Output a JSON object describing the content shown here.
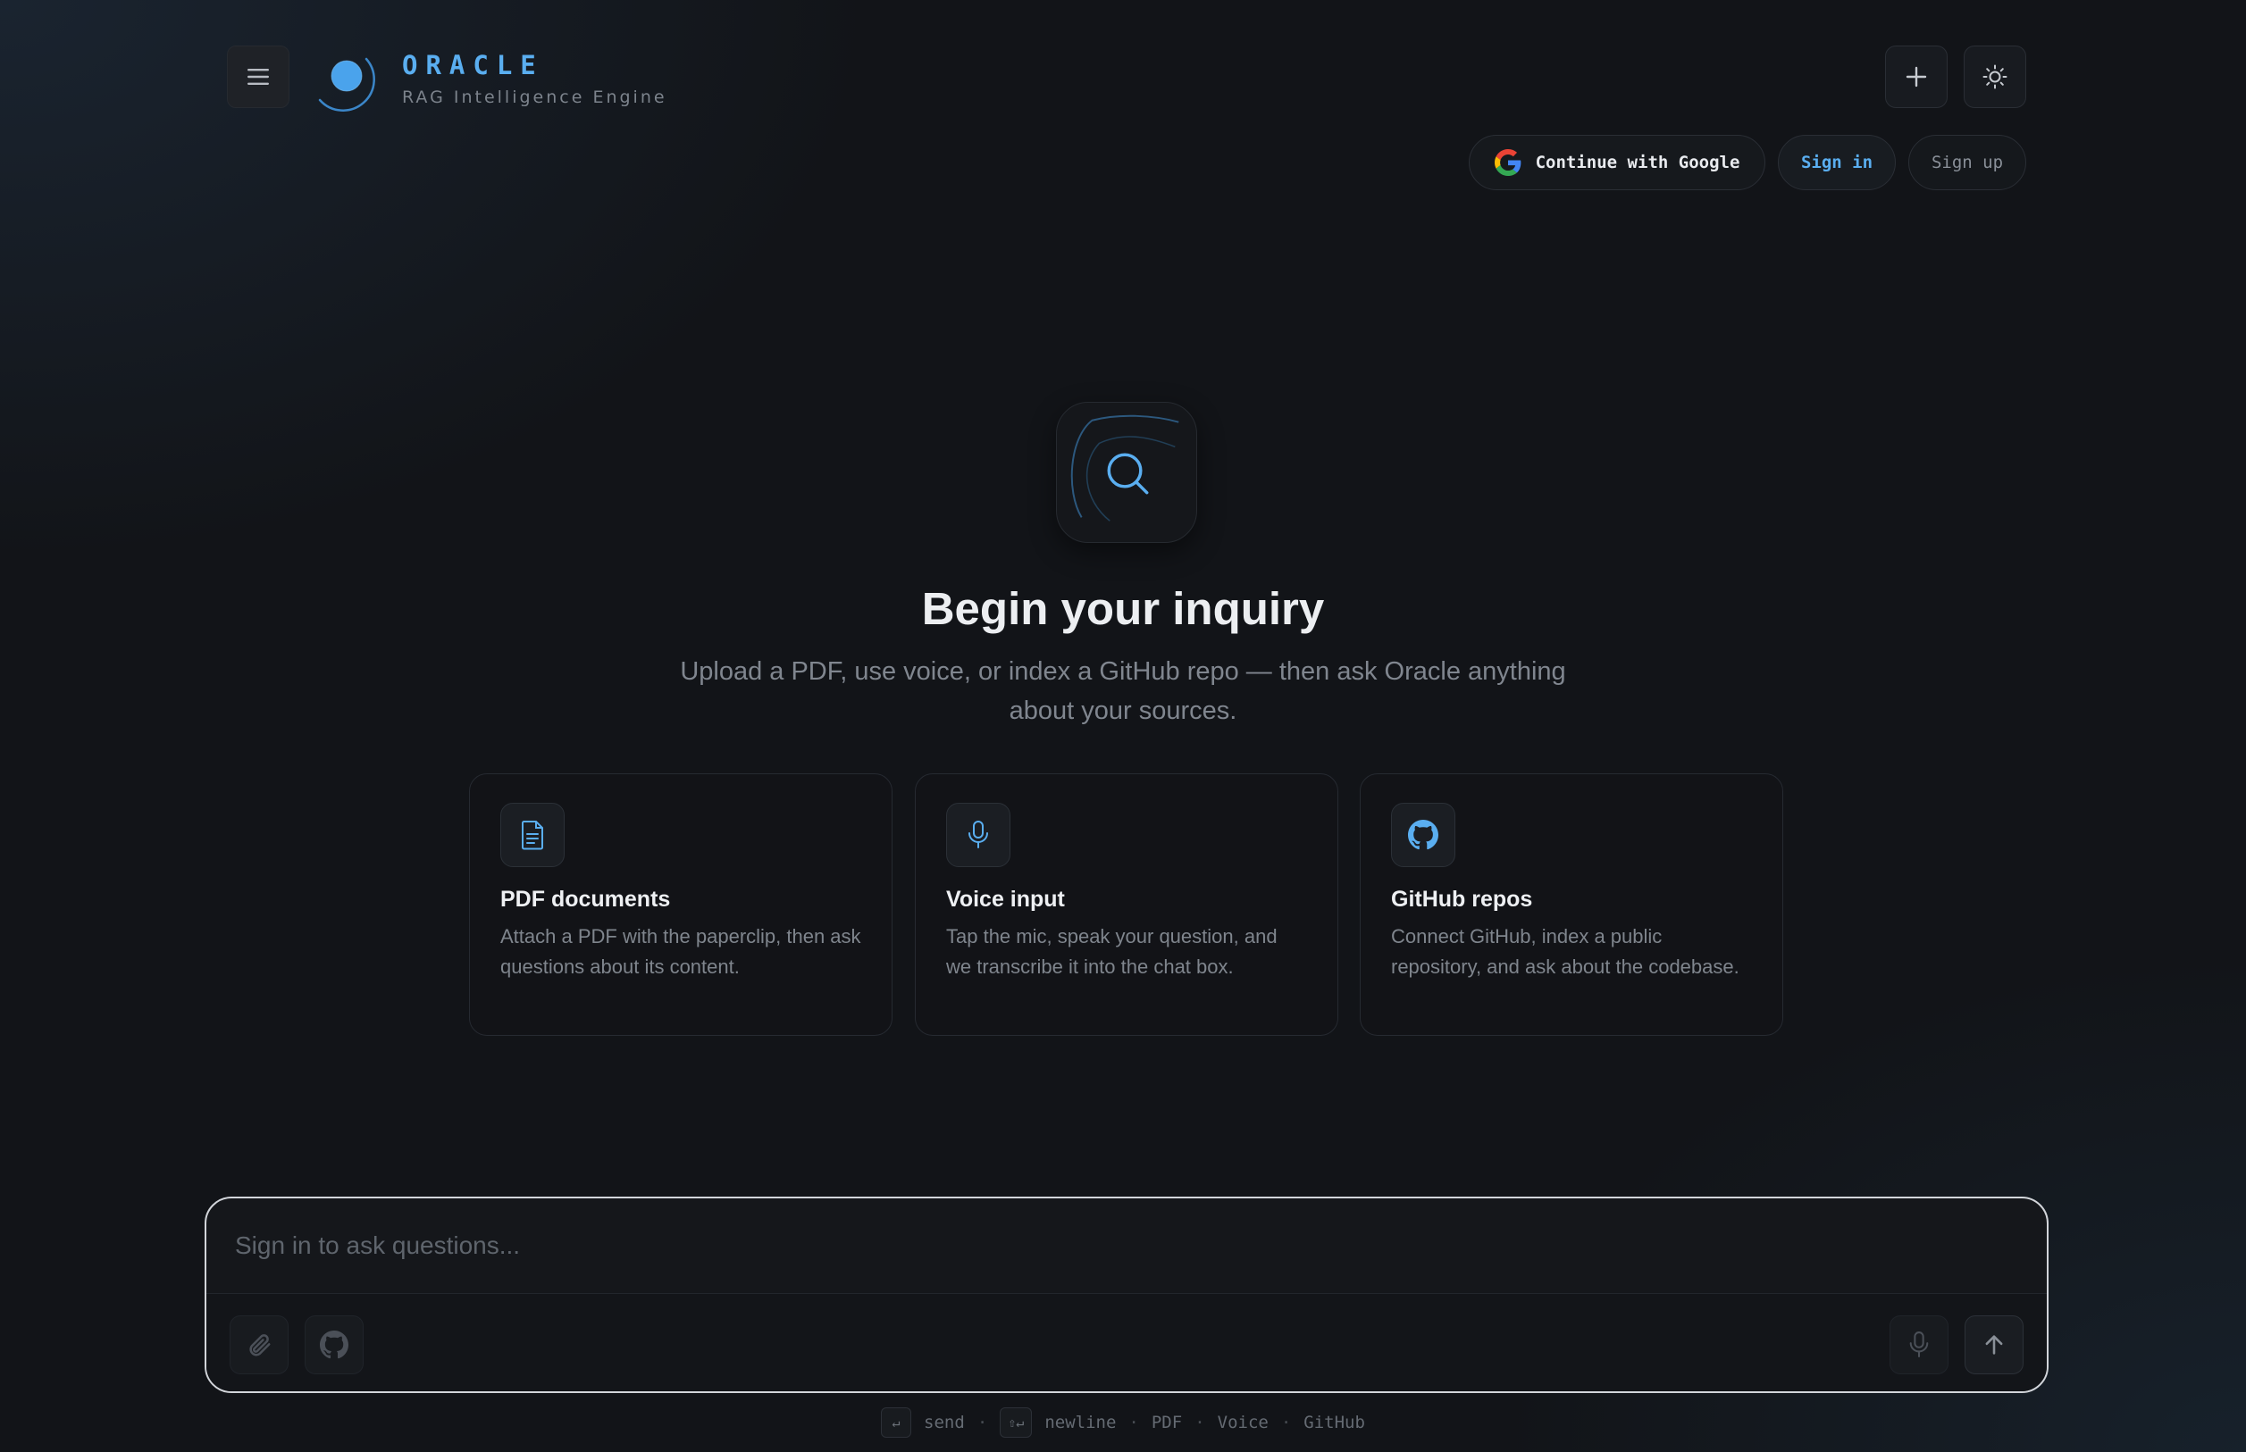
{
  "header": {
    "brand_title": "ORACLE",
    "brand_subtitle": "RAG Intelligence Engine",
    "menu_icon": "hamburger-menu-icon",
    "new_chat_icon": "plus-icon",
    "theme_icon": "sun-icon"
  },
  "auth": {
    "google_label": "Continue with Google",
    "signin_label": "Sign in",
    "signup_label": "Sign up"
  },
  "hero": {
    "icon": "search-icon",
    "title": "Begin your inquiry",
    "subtitle": "Upload a PDF, use voice, or index a GitHub repo — then ask Oracle anything about your sources."
  },
  "cards": [
    {
      "icon": "document-icon",
      "title": "PDF documents",
      "description": "Attach a PDF with the paperclip, then ask questions about its content."
    },
    {
      "icon": "microphone-icon",
      "title": "Voice input",
      "description": "Tap the mic, speak your question, and we transcribe it into the chat box."
    },
    {
      "icon": "github-icon",
      "title": "GitHub repos",
      "description": "Connect GitHub, index a public repository, and ask about the codebase."
    }
  ],
  "chat": {
    "placeholder": "Sign in to ask questions...",
    "value": ""
  },
  "hints": {
    "send_key": "↵",
    "send_label": "send",
    "newline_key": "⇧↵",
    "newline_label": "newline",
    "pdf": "PDF",
    "voice": "Voice",
    "github": "GitHub",
    "separator": "·"
  },
  "colors": {
    "accent": "#5aaef0",
    "background": "#121418",
    "card_border": "#262a31",
    "chat_border": "#d2d5da"
  }
}
